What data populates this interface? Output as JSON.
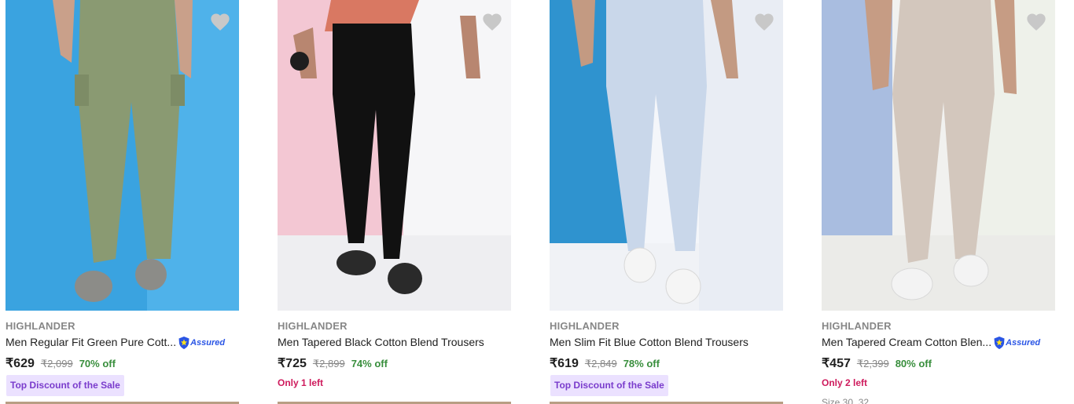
{
  "products": [
    {
      "brand": "HIGHLANDER",
      "title": "Men Regular Fit Green Pure Cott...",
      "price": "₹629",
      "mrp": "₹2,099",
      "discount": "70% off",
      "assured": true,
      "assured_label": "Assured",
      "tag": "Top Discount of the Sale",
      "stock": ""
    },
    {
      "brand": "HIGHLANDER",
      "title": "Men Tapered Black Cotton Blend Trousers",
      "price": "₹725",
      "mrp": "₹2,899",
      "discount": "74% off",
      "assured": false,
      "tag": "",
      "stock": "Only 1 left"
    },
    {
      "brand": "HIGHLANDER",
      "title": "Men Slim Fit Blue Cotton Blend Trousers",
      "price": "₹619",
      "mrp": "₹2,849",
      "discount": "78% off",
      "assured": false,
      "tag": "Top Discount of the Sale",
      "stock": ""
    },
    {
      "brand": "HIGHLANDER",
      "title": "Men Tapered Cream Cotton Blen...",
      "price": "₹457",
      "mrp": "₹2,399",
      "discount": "80% off",
      "assured": true,
      "assured_label": "Assured",
      "tag": "",
      "stock": "Only 2 left",
      "sizes_partial": "Size 30, 32"
    }
  ],
  "colors": {
    "price_discount": "#388e3c",
    "stock_warning": "#ce1a5c",
    "badge_bg": "#ebe1ff",
    "badge_text": "#7a3ccc",
    "wishlist_heart": "#c8c8c8"
  },
  "icons": {
    "wishlist": "heart-icon",
    "assured": "assured-shield-icon"
  }
}
